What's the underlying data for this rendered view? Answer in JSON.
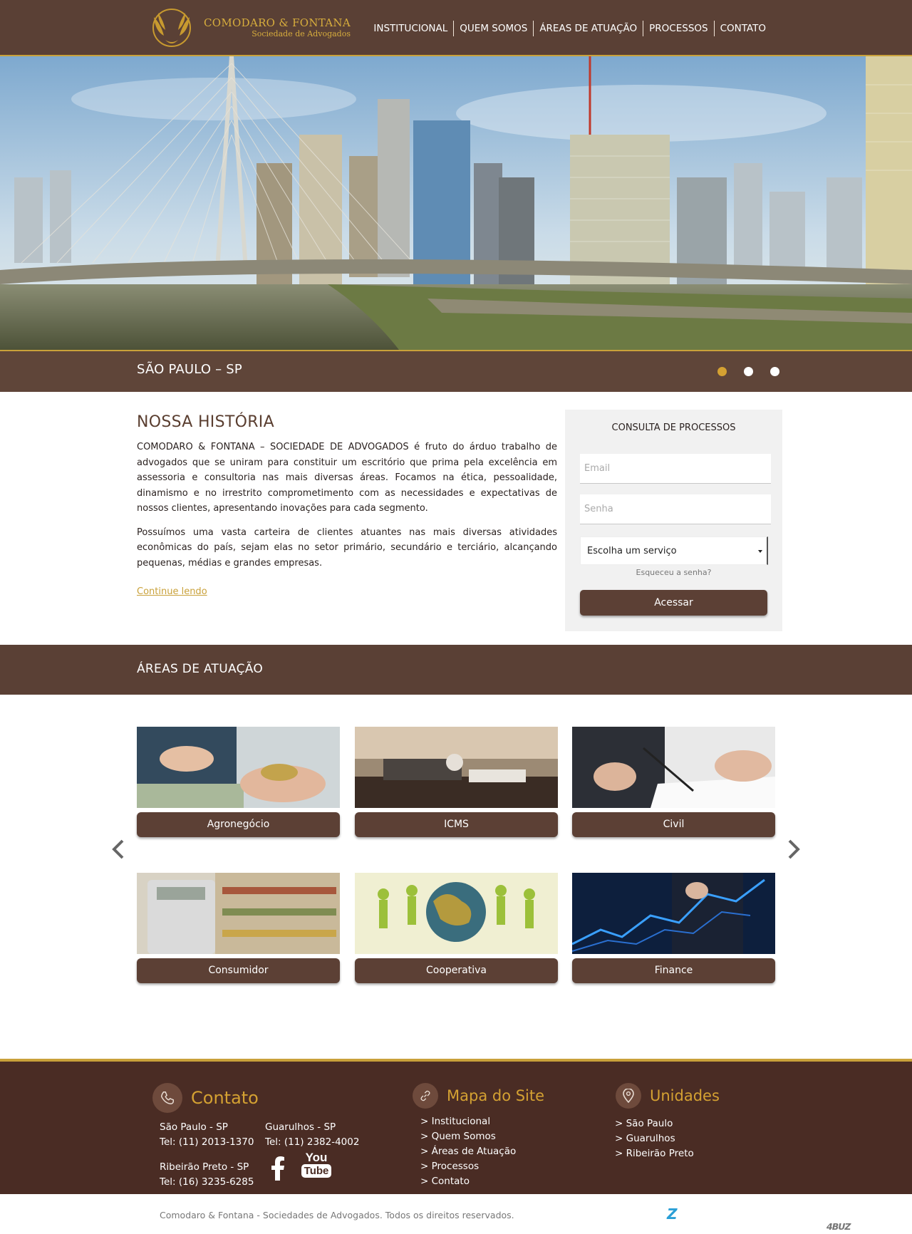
{
  "header": {
    "logo_name": "COMODARO & FONTANA",
    "logo_sub": "Sociedade de Advogados",
    "nav": [
      "INSTITUCIONAL",
      "QUEM SOMOS",
      "ÁREAS DE ATUAÇÃO",
      "PROCESSOS",
      "CONTATO"
    ]
  },
  "hero": {
    "caption": "SÃO PAULO – SP",
    "slides": 3,
    "active_slide": 1
  },
  "history": {
    "title": "NOSSA HISTÓRIA",
    "p1": "COMODARO & FONTANA – SOCIEDADE DE ADVOGADOS é fruto do árduo trabalho de advogados que se uniram para constituir um escritório que prima pela excelência em assessoria e consultoria nas mais diversas áreas. Focamos na ética, pessoalidade, dinamismo e no irrestrito comprometimento com as necessidades e expectativas de nossos clientes, apresentando inovações para cada segmento.",
    "p2": "Possuímos uma vasta carteira de clientes atuantes nas mais diversas atividades econômicas do país, sejam elas no setor primário, secundário e terciário, alcançando pequenas, médias e grandes empresas.",
    "more": "Continue lendo"
  },
  "login": {
    "title": "CONSULTA DE PROCESSOS",
    "email_placeholder": "Email",
    "password_placeholder": "Senha",
    "service_select": "Escolha um serviço",
    "forgot": "Esqueceu a senha?",
    "submit": "Acessar"
  },
  "areas": {
    "title": "ÁREAS DE ATUAÇÃO",
    "cards": [
      "Agronegócio",
      "ICMS",
      "Civil",
      "Consumidor",
      "Cooperativa",
      "Finance"
    ]
  },
  "footer": {
    "contato": {
      "title": "Contato",
      "sp_city": "São Paulo - SP",
      "sp_tel": "Tel: (11) 2013-1370",
      "gru_city": "Guarulhos - SP",
      "gru_tel": "Tel: (11) 2382-4002",
      "rp_city": "Ribeirão Preto - SP",
      "rp_tel": "Tel: (16) 3235-6285",
      "youtube_top": "You",
      "youtube_bottom": "Tube"
    },
    "mapa": {
      "title": "Mapa do Site",
      "links": [
        "> Institucional",
        "> Quem Somos",
        "> Áreas de Atuação",
        "> Processos",
        "> Contato"
      ]
    },
    "unidades": {
      "title": "Unidades",
      "links": [
        "> São Paulo",
        "> Guarulhos",
        "> Ribeirão Preto"
      ]
    },
    "copyright": "Comodaro & Fontana - Sociedades de Advogados. Todos os direitos reservados.",
    "agency_logo_a": "4BUZ",
    "agency_logo_b": "Z"
  },
  "colors": {
    "brown": "#5a4035",
    "dark_brown": "#4a2c24",
    "gold": "#c9a13a",
    "panel": "#f1f1f1"
  }
}
